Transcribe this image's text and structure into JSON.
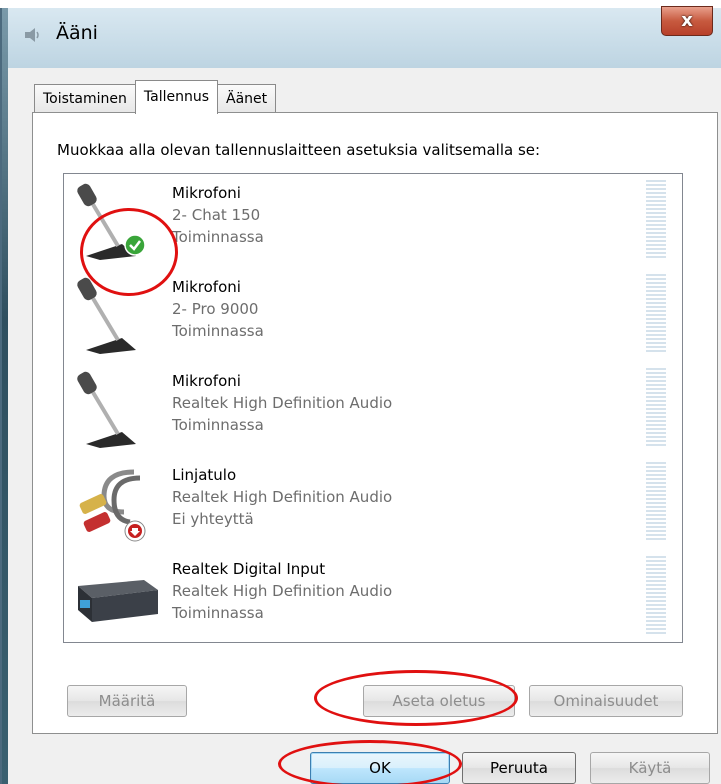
{
  "window": {
    "title": "Ääni",
    "close_label": "x"
  },
  "tabs": [
    {
      "label": "Toistaminen"
    },
    {
      "label": "Tallennus"
    },
    {
      "label": "Äänet"
    }
  ],
  "instruction": "Muokkaa alla olevan tallennuslaitteen asetuksia valitsemalla se:",
  "devices": [
    {
      "name": "Mikrofoni",
      "detail": "2- Chat 150",
      "status": "Toiminnassa",
      "icon": "microphone-icon",
      "badge": "default-check-badge"
    },
    {
      "name": "Mikrofoni",
      "detail": "2- Pro 9000",
      "status": "Toiminnassa",
      "icon": "microphone-icon"
    },
    {
      "name": "Mikrofoni",
      "detail": "Realtek High Definition Audio",
      "status": "Toiminnassa",
      "icon": "microphone-icon"
    },
    {
      "name": "Linjatulo",
      "detail": "Realtek High Definition Audio",
      "status": "Ei yhteyttä",
      "icon": "line-in-cable-icon",
      "badge": "disconnected-badge"
    },
    {
      "name": "Realtek Digital Input",
      "detail": "Realtek High Definition Audio",
      "status": "Toiminnassa",
      "icon": "digital-input-device-icon"
    }
  ],
  "panel_buttons": {
    "configure": "Määritä",
    "set_default": "Aseta oletus",
    "properties": "Ominaisuudet"
  },
  "dialog_buttons": {
    "ok": "OK",
    "cancel": "Peruuta",
    "apply": "Käytä"
  },
  "colors": {
    "annotation": "#e01010",
    "accent": "#3c7fb1"
  }
}
